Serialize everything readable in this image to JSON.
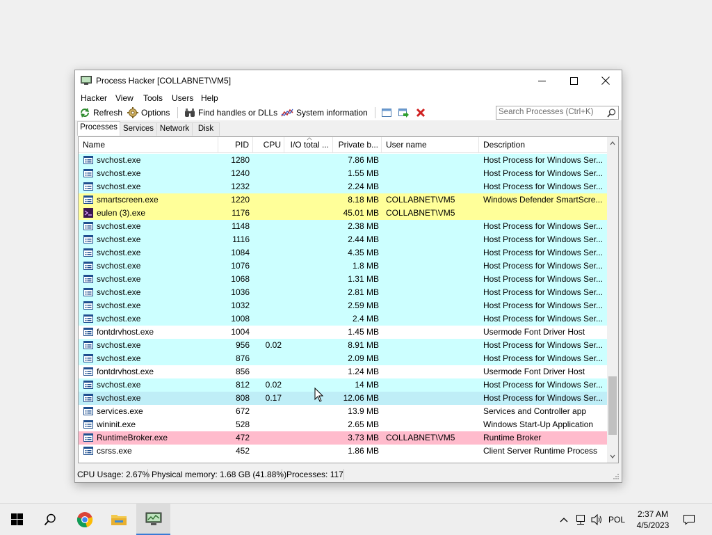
{
  "window": {
    "title": "Process Hacker [COLLABNET\\VM5]"
  },
  "menu": [
    "Hacker",
    "View",
    "Tools",
    "Users",
    "Help"
  ],
  "toolbar": {
    "refresh": "Refresh",
    "options": "Options",
    "find_handles": "Find handles or DLLs",
    "system_info": "System information",
    "search_placeholder": "Search Processes (Ctrl+K)"
  },
  "tabs": [
    "Processes",
    "Services",
    "Network",
    "Disk"
  ],
  "columns": [
    "Name",
    "PID",
    "CPU",
    "I/O total ...",
    "Private b...",
    "User name",
    "Description"
  ],
  "processes": [
    {
      "name": "svchost.exe",
      "pid": "1280",
      "cpu": "",
      "io": "",
      "private": "7.86 MB",
      "user": "",
      "desc": "Host Process for Windows Ser..."
    },
    {
      "name": "svchost.exe",
      "pid": "1240",
      "cpu": "",
      "io": "",
      "private": "1.55 MB",
      "user": "",
      "desc": "Host Process for Windows Ser..."
    },
    {
      "name": "svchost.exe",
      "pid": "1232",
      "cpu": "",
      "io": "",
      "private": "2.24 MB",
      "user": "",
      "desc": "Host Process for Windows Ser..."
    },
    {
      "name": "smartscreen.exe",
      "pid": "1220",
      "cpu": "",
      "io": "",
      "private": "8.18 MB",
      "user": "COLLABNET\\VM5",
      "desc": "Windows Defender SmartScre..."
    },
    {
      "name": "eulen (3).exe",
      "pid": "1176",
      "cpu": "",
      "io": "",
      "private": "45.01 MB",
      "user": "COLLABNET\\VM5",
      "desc": ""
    },
    {
      "name": "svchost.exe",
      "pid": "1148",
      "cpu": "",
      "io": "",
      "private": "2.38 MB",
      "user": "",
      "desc": "Host Process for Windows Ser..."
    },
    {
      "name": "svchost.exe",
      "pid": "1116",
      "cpu": "",
      "io": "",
      "private": "2.44 MB",
      "user": "",
      "desc": "Host Process for Windows Ser..."
    },
    {
      "name": "svchost.exe",
      "pid": "1084",
      "cpu": "",
      "io": "",
      "private": "4.35 MB",
      "user": "",
      "desc": "Host Process for Windows Ser..."
    },
    {
      "name": "svchost.exe",
      "pid": "1076",
      "cpu": "",
      "io": "",
      "private": "1.8 MB",
      "user": "",
      "desc": "Host Process for Windows Ser..."
    },
    {
      "name": "svchost.exe",
      "pid": "1068",
      "cpu": "",
      "io": "",
      "private": "1.31 MB",
      "user": "",
      "desc": "Host Process for Windows Ser..."
    },
    {
      "name": "svchost.exe",
      "pid": "1036",
      "cpu": "",
      "io": "",
      "private": "2.81 MB",
      "user": "",
      "desc": "Host Process for Windows Ser..."
    },
    {
      "name": "svchost.exe",
      "pid": "1032",
      "cpu": "",
      "io": "",
      "private": "2.59 MB",
      "user": "",
      "desc": "Host Process for Windows Ser..."
    },
    {
      "name": "svchost.exe",
      "pid": "1008",
      "cpu": "",
      "io": "",
      "private": "2.4 MB",
      "user": "",
      "desc": "Host Process for Windows Ser..."
    },
    {
      "name": "fontdrvhost.exe",
      "pid": "1004",
      "cpu": "",
      "io": "",
      "private": "1.45 MB",
      "user": "",
      "desc": "Usermode Font Driver Host"
    },
    {
      "name": "svchost.exe",
      "pid": "956",
      "cpu": "0.02",
      "io": "",
      "private": "8.91 MB",
      "user": "",
      "desc": "Host Process for Windows Ser..."
    },
    {
      "name": "svchost.exe",
      "pid": "876",
      "cpu": "",
      "io": "",
      "private": "2.09 MB",
      "user": "",
      "desc": "Host Process for Windows Ser..."
    },
    {
      "name": "fontdrvhost.exe",
      "pid": "856",
      "cpu": "",
      "io": "",
      "private": "1.24 MB",
      "user": "",
      "desc": "Usermode Font Driver Host"
    },
    {
      "name": "svchost.exe",
      "pid": "812",
      "cpu": "0.02",
      "io": "",
      "private": "14 MB",
      "user": "",
      "desc": "Host Process for Windows Ser..."
    },
    {
      "name": "svchost.exe",
      "pid": "808",
      "cpu": "0.17",
      "io": "",
      "private": "12.06 MB",
      "user": "",
      "desc": "Host Process for Windows Ser..."
    },
    {
      "name": "services.exe",
      "pid": "672",
      "cpu": "",
      "io": "",
      "private": "13.9 MB",
      "user": "",
      "desc": "Services and Controller app"
    },
    {
      "name": "wininit.exe",
      "pid": "528",
      "cpu": "",
      "io": "",
      "private": "2.65 MB",
      "user": "",
      "desc": "Windows Start-Up Application"
    },
    {
      "name": "RuntimeBroker.exe",
      "pid": "472",
      "cpu": "",
      "io": "",
      "private": "3.73 MB",
      "user": "COLLABNET\\VM5",
      "desc": "Runtime Broker"
    },
    {
      "name": "csrss.exe",
      "pid": "452",
      "cpu": "",
      "io": "",
      "private": "1.86 MB",
      "user": "",
      "desc": "Client Server Runtime Process"
    }
  ],
  "colors": {
    "service": "#ccffff",
    "service_selected": "#bfeef7",
    "user_process": "#ffff99",
    "packed": "#ffbbcc",
    "normal": "#ffffff"
  },
  "status": {
    "cpu": "CPU Usage: 2.67%",
    "memory": "Physical memory: 1.68 GB (41.88%)",
    "processes": "Processes: 117"
  },
  "taskbar": {
    "apps": [
      "start-button",
      "search",
      "chrome",
      "file-explorer",
      "process-hacker"
    ],
    "language": "POL",
    "time": "2:37 AM",
    "date": "4/5/2023"
  }
}
